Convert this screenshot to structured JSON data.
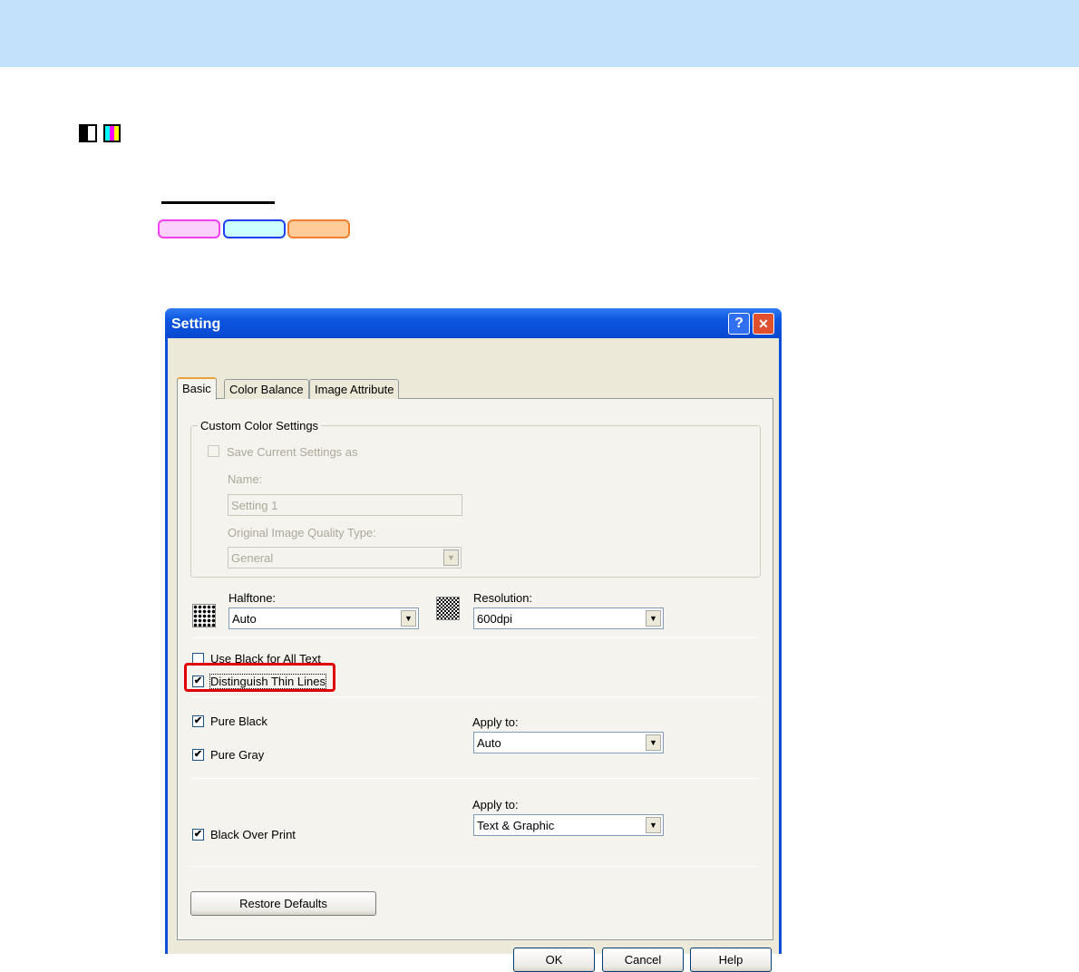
{
  "dialog": {
    "title": "Setting",
    "help_btn": "?",
    "close_btn": "✕"
  },
  "tabs": [
    {
      "label": "Basic"
    },
    {
      "label": "Color Balance"
    },
    {
      "label": "Image Attribute"
    }
  ],
  "custom": {
    "group": "Custom Color Settings",
    "save_label": "Save Current Settings as",
    "name_label": "Name:",
    "name_value": "Setting 1",
    "quality_label": "Original Image Quality Type:",
    "quality_value": "General"
  },
  "halftone": {
    "label": "Halftone:",
    "value": "Auto"
  },
  "resolution": {
    "label": "Resolution:",
    "value": "600dpi"
  },
  "options": {
    "use_black": "Use Black for All Text",
    "thin_lines": "Distinguish Thin Lines",
    "pure_black": "Pure Black",
    "pure_gray": "Pure Gray",
    "apply_to1": "Apply to:",
    "apply_value1": "Auto",
    "apply_to2": "Apply to:",
    "apply_value2": "Text & Graphic",
    "black_over": "Black Over Print"
  },
  "buttons": {
    "restore": "Restore Defaults",
    "ok": "OK",
    "cancel": "Cancel",
    "help": "Help"
  },
  "check_mark": "✔",
  "highlight_color": "#e00000"
}
